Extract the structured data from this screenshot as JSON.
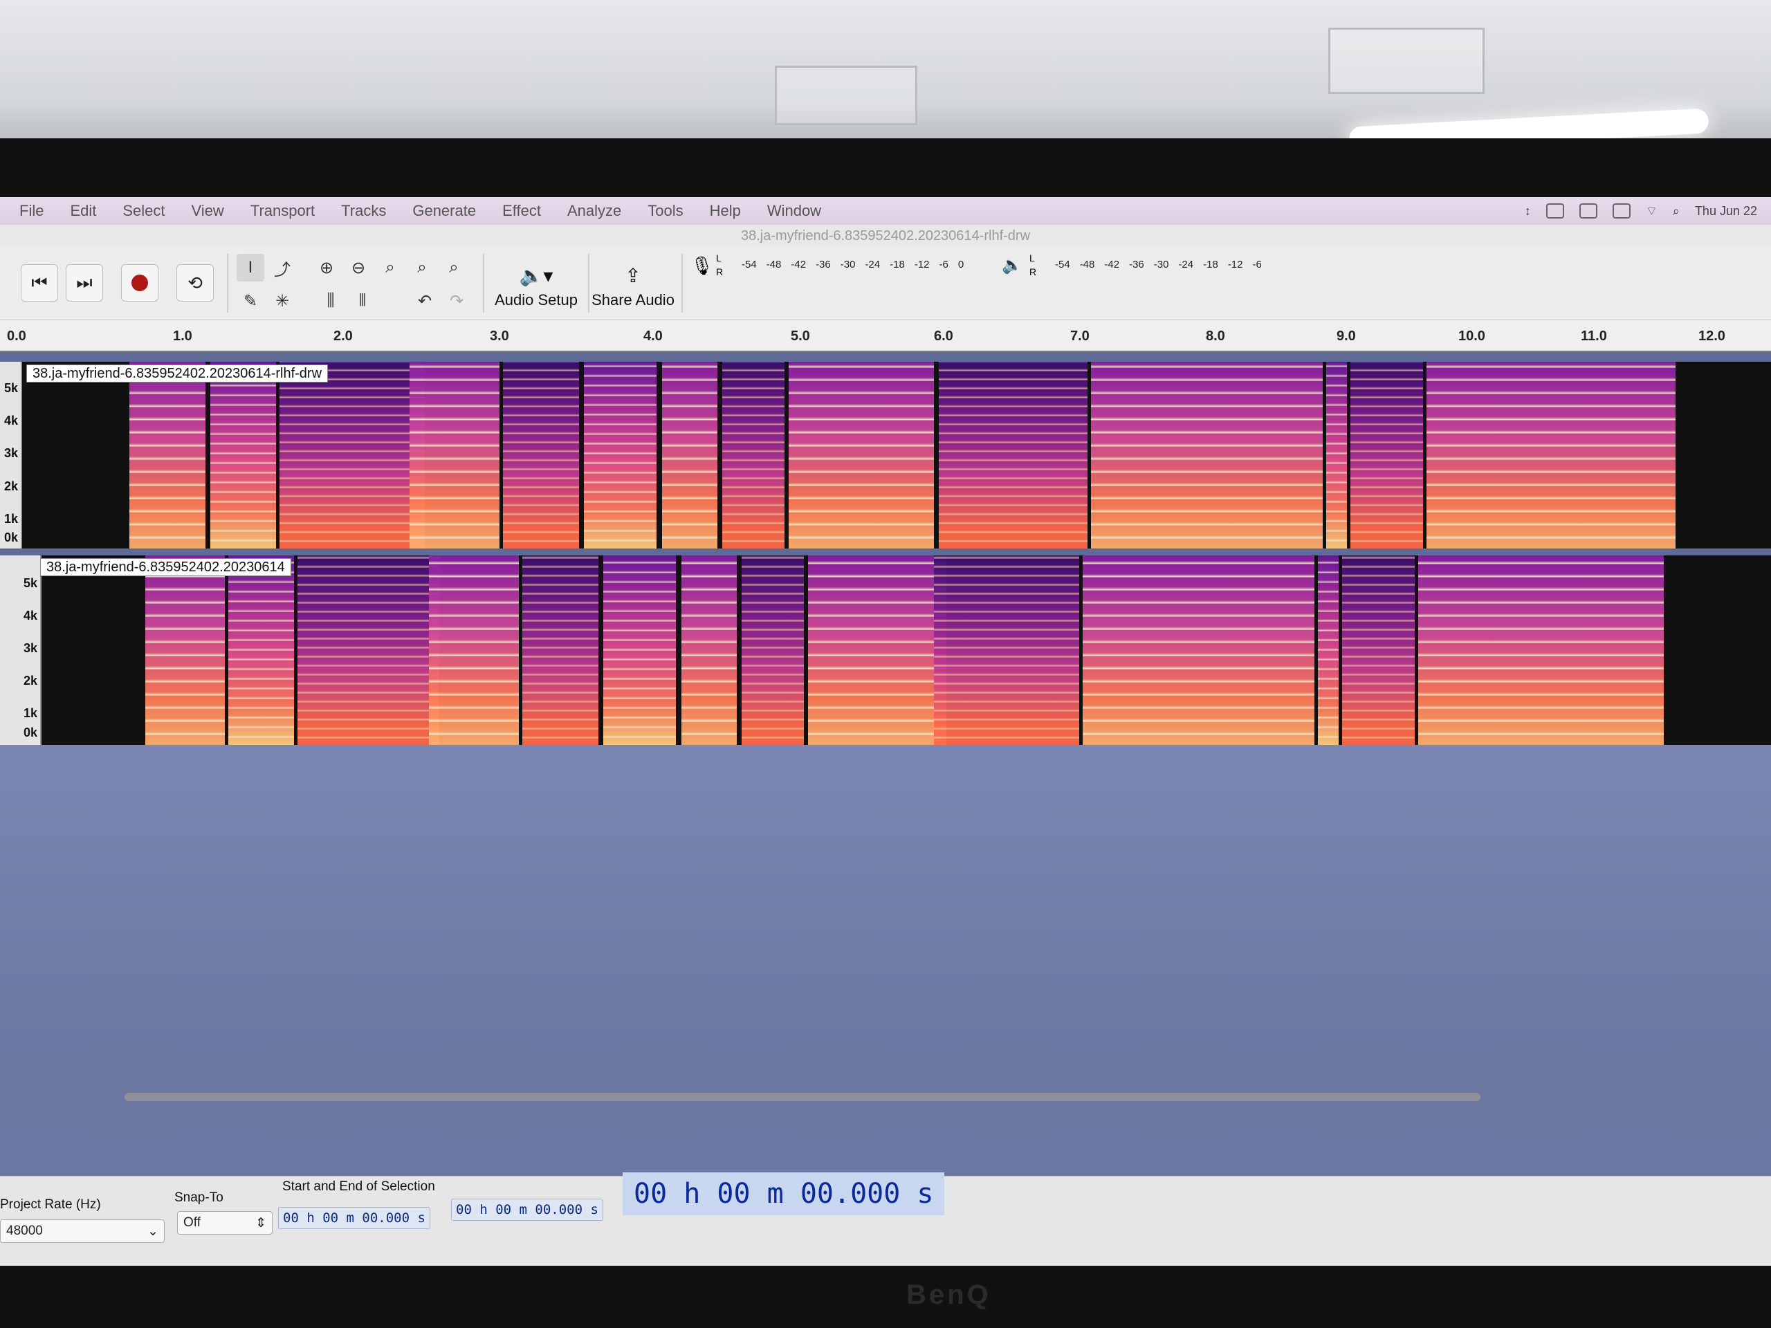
{
  "menu": [
    "File",
    "Edit",
    "Select",
    "View",
    "Transport",
    "Tracks",
    "Generate",
    "Effect",
    "Analyze",
    "Tools",
    "Help",
    "Window"
  ],
  "status_clock": "Thu Jun 22",
  "window_title": "38.ja-myfriend-6.835952402.20230614-rlhf-drw",
  "toolbar": {
    "audio_setup_label": "Audio Setup",
    "share_audio_label": "Share Audio",
    "record_meter_ticks": [
      "-54",
      "-48",
      "-42",
      "-36",
      "-30",
      "-24",
      "-18",
      "-12",
      "-6",
      "0"
    ],
    "playback_meter_ticks": [
      "-54",
      "-48",
      "-42",
      "-36",
      "-30",
      "-24",
      "-18",
      "-12",
      "-6"
    ],
    "meter_lr": [
      "L",
      "R"
    ]
  },
  "ruler_ticks": [
    "0.0",
    "1.0",
    "2.0",
    "3.0",
    "4.0",
    "5.0",
    "6.0",
    "7.0",
    "8.0",
    "9.0",
    "10.0",
    "11.0",
    "12.0"
  ],
  "tracks": [
    {
      "name": "38.ja-myfriend-6.835952402.20230614-rlhf-drw",
      "axis": [
        "5k",
        "4k",
        "3k",
        "2k",
        "1k",
        "0k"
      ]
    },
    {
      "name": "38.ja-myfriend-6.835952402.20230614",
      "axis": [
        "5k",
        "4k",
        "3k",
        "2k",
        "1k",
        "0k"
      ]
    }
  ],
  "bottom": {
    "project_rate_label": "Project Rate (Hz)",
    "project_rate_value": "48000",
    "snap_to_label": "Snap-To",
    "snap_to_value": "Off",
    "selection_label": "Start and End of Selection",
    "sel_start": "00 h 00 m 00.000 s",
    "sel_end": "00 h 00 m 00.000 s",
    "big_time": "00 h 00 m 00.000 s"
  },
  "monitor_brand": "BenQ"
}
